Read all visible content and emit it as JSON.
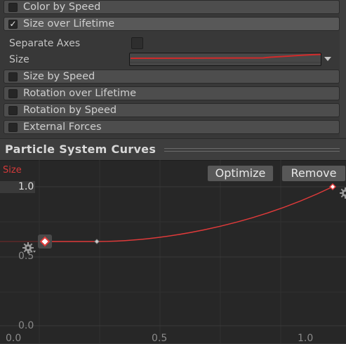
{
  "modules": {
    "color_by_speed": "Color by Speed",
    "size_over_lifetime": "Size over Lifetime",
    "size_by_speed": "Size by Speed",
    "rotation_over_lifetime": "Rotation over Lifetime",
    "rotation_by_speed": "Rotation by Speed",
    "external_forces": "External Forces"
  },
  "checkmark": "✓",
  "properties": {
    "separate_axes": "Separate Axes",
    "size": "Size"
  },
  "curves_panel": {
    "title": "Particle System Curves",
    "curve_name": "Size",
    "optimize": "Optimize",
    "remove": "Remove"
  },
  "axis": {
    "y_ticks": [
      "1.0",
      "0.5",
      "0.0"
    ],
    "x_ticks": [
      "0.0",
      "0.5",
      "1.0"
    ]
  },
  "colors": {
    "curve": "#e03a3a",
    "accent_text": "#d43a3a"
  },
  "icons": {
    "gear": "gear-icon",
    "dropdown": "dropdown-arrow-icon",
    "checkmark": "checkmark-icon"
  }
}
